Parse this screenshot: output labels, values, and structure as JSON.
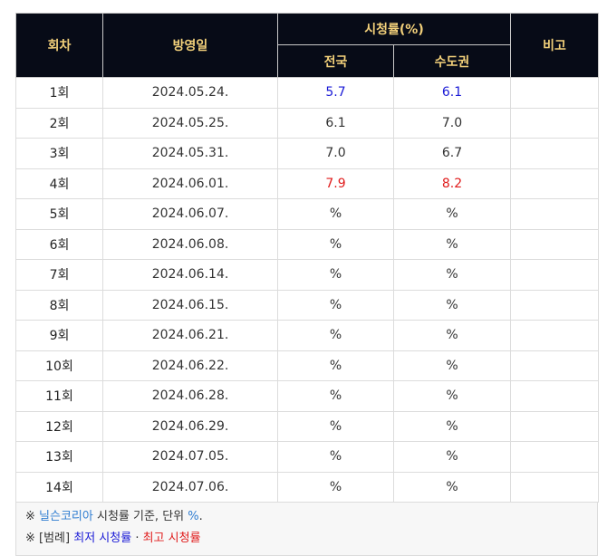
{
  "header": {
    "col_episode": "회차",
    "col_date": "방영일",
    "col_rating": "시청률(%)",
    "col_national": "전국",
    "col_capital": "수도권",
    "col_note": "비고"
  },
  "rows": [
    {
      "ep": "1회",
      "date": "2024.05.24.",
      "national": "5.7",
      "capital": "6.1",
      "note": ""
    },
    {
      "ep": "2회",
      "date": "2024.05.25.",
      "national": "6.1",
      "capital": "7.0",
      "note": ""
    },
    {
      "ep": "3회",
      "date": "2024.05.31.",
      "national": "7.0",
      "capital": "6.7",
      "note": ""
    },
    {
      "ep": "4회",
      "date": "2024.06.01.",
      "national": "7.9",
      "capital": "8.2",
      "note": ""
    },
    {
      "ep": "5회",
      "date": "2024.06.07.",
      "national": "%",
      "capital": "%",
      "note": ""
    },
    {
      "ep": "6회",
      "date": "2024.06.08.",
      "national": "%",
      "capital": "%",
      "note": ""
    },
    {
      "ep": "7회",
      "date": "2024.06.14.",
      "national": "%",
      "capital": "%",
      "note": ""
    },
    {
      "ep": "8회",
      "date": "2024.06.15.",
      "national": "%",
      "capital": "%",
      "note": ""
    },
    {
      "ep": "9회",
      "date": "2024.06.21.",
      "national": "%",
      "capital": "%",
      "note": ""
    },
    {
      "ep": "10회",
      "date": "2024.06.22.",
      "national": "%",
      "capital": "%",
      "note": ""
    },
    {
      "ep": "11회",
      "date": "2024.06.28.",
      "national": "%",
      "capital": "%",
      "note": ""
    },
    {
      "ep": "12회",
      "date": "2024.06.29.",
      "national": "%",
      "capital": "%",
      "note": ""
    },
    {
      "ep": "13회",
      "date": "2024.07.05.",
      "national": "%",
      "capital": "%",
      "note": ""
    },
    {
      "ep": "14회",
      "date": "2024.07.06.",
      "national": "%",
      "capital": "%",
      "note": ""
    }
  ],
  "footer": {
    "line1_mark": "※",
    "line1_source": "닐슨코리아",
    "line1_text": " 시청률 기준, 단위 ",
    "line1_unit": "%",
    "line1_end": ".",
    "line2_mark": "※ [범례]",
    "line2_low": "최저 시청률",
    "line2_sep": "·",
    "line2_high": "최고 시청률"
  },
  "colors": {
    "header_bg": "#070b17",
    "header_text": "#f2d07a",
    "lowest": "#1a1ad6",
    "highest": "#e01b1b",
    "source_link": "#2f7dd1"
  }
}
